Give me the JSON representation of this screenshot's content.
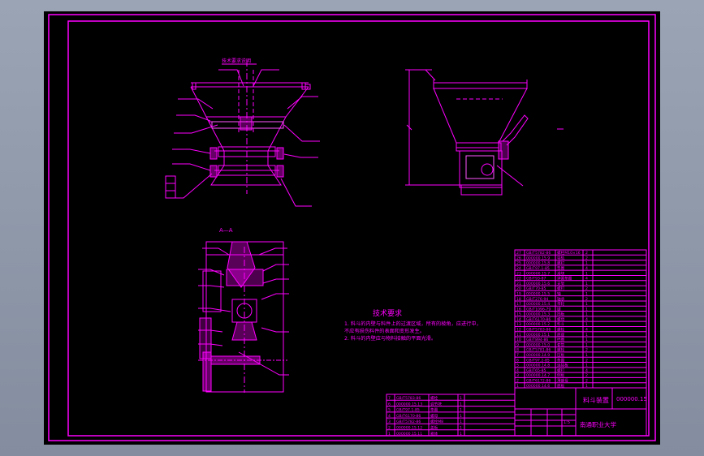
{
  "colors": {
    "background": "#000000",
    "frame": "#ff00ff",
    "workspace": "#8a94a6"
  },
  "views": {
    "section_label": "A—A",
    "top_note": "技术要求说明"
  },
  "tech_requirements": {
    "title": "技术要求",
    "line1": "1. 料斗的内壁与料件上的过渡区域，所有的棱角，应进行中，",
    "line2": "不应有损伤料件的表面和变形发生。",
    "line3": "2. 料斗的内壁应与物料接触的平面光滑。"
  },
  "title_block": {
    "drawing_name": "料斗装置",
    "drawing_no": "000000.15",
    "company": "南通职业大学",
    "scale": "1:5"
  },
  "parts_list": [
    {
      "no": "27",
      "code": "GB/T5782-86",
      "name": "螺栓M10×16",
      "qty": "2"
    },
    {
      "no": "26",
      "code": "000000.15.9",
      "name": "导轨",
      "qty": "2"
    },
    {
      "no": "25",
      "code": "000000.15.8",
      "name": "螺钉",
      "qty": "1"
    },
    {
      "no": "24",
      "code": "GB/T97.1-85",
      "name": "垫圈",
      "qty": "4"
    },
    {
      "no": "23",
      "code": "000000.15.7",
      "name": "滑块",
      "qty": "1"
    },
    {
      "no": "22",
      "code": "GB/T93-87",
      "name": "弹簧垫圈",
      "qty": "4"
    },
    {
      "no": "21",
      "code": "000000.15.6",
      "name": "支架",
      "qty": "1"
    },
    {
      "no": "20",
      "code": "GB/T70-85",
      "name": "螺钉",
      "qty": "2"
    },
    {
      "no": "19",
      "code": "000000.15.5",
      "name": "轴",
      "qty": "1"
    },
    {
      "no": "18",
      "code": "GB/T276-94",
      "name": "轴承",
      "qty": "2"
    },
    {
      "no": "17",
      "code": "000000.15.4",
      "name": "带轮",
      "qty": "1"
    },
    {
      "no": "16",
      "code": "GB/T1096-79",
      "name": "键",
      "qty": "1"
    },
    {
      "no": "15",
      "code": "000000.15.3",
      "name": "挡板",
      "qty": "1"
    },
    {
      "no": "14",
      "code": "GB/T6170-86",
      "name": "螺母",
      "qty": "4"
    },
    {
      "no": "13",
      "code": "000000.15.2",
      "name": "料斗",
      "qty": "1"
    },
    {
      "no": "12",
      "code": "GB/T5783-86",
      "name": "螺栓",
      "qty": "4"
    },
    {
      "no": "11",
      "code": "000000.15.1",
      "name": "底座",
      "qty": "1"
    },
    {
      "no": "10",
      "code": "GB/T894-86",
      "name": "挡圈",
      "qty": "1"
    },
    {
      "no": "9",
      "code": "000000.15.0",
      "name": "套筒",
      "qty": "1"
    },
    {
      "no": "8",
      "code": "GB/T5781-86",
      "name": "螺栓",
      "qty": "2"
    },
    {
      "no": "7",
      "code": "000000.14.9",
      "name": "压板",
      "qty": "1"
    },
    {
      "no": "6",
      "code": "GB/T97.2-85",
      "name": "垫圈",
      "qty": "2"
    },
    {
      "no": "5",
      "code": "000000.14.8",
      "name": "连接板",
      "qty": "1"
    },
    {
      "no": "4",
      "code": "GB/T65-85",
      "name": "螺钉",
      "qty": "4"
    },
    {
      "no": "3",
      "code": "000000.14.7",
      "name": "侧板",
      "qty": "2"
    },
    {
      "no": "2",
      "code": "GB/T6172-86",
      "name": "薄螺母",
      "qty": "2"
    },
    {
      "no": "1",
      "code": "000000.14.6",
      "name": "底板",
      "qty": "1"
    }
  ],
  "bottom_list": [
    {
      "no": "7",
      "code": "GB/T5783-86",
      "name": "螺栓",
      "qty": "1"
    },
    {
      "no": "6",
      "code": "000000.15.13",
      "name": "调节块",
      "qty": "1"
    },
    {
      "no": "5",
      "code": "GB/T97.1-85",
      "name": "垫圈",
      "qty": "1"
    },
    {
      "no": "4",
      "code": "GB/T6170-86",
      "name": "螺母",
      "qty": "1"
    },
    {
      "no": "3",
      "code": "GB/T5782-86",
      "name": "螺栓M8",
      "qty": "1"
    },
    {
      "no": "2",
      "code": "000000.15.12",
      "name": "盖板",
      "qty": "1"
    },
    {
      "no": "1",
      "code": "000000.15.11",
      "name": "箱体",
      "qty": "1"
    }
  ]
}
